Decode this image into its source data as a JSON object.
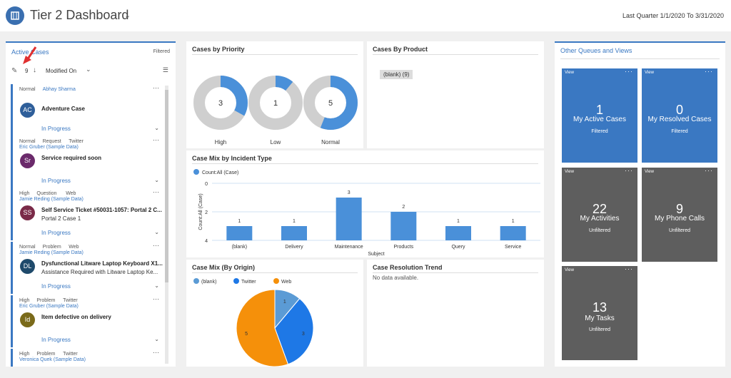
{
  "header": {
    "title": "Tier 2 Dashboard",
    "date_range": "Last Quarter 1/1/2020 To 3/31/2020"
  },
  "left_panel": {
    "title": "Active Cases",
    "filter": "Filtered",
    "count": "9",
    "sort": "Modified On",
    "cases": [
      {
        "tags": [
          "Normal",
          "Abhay Sharma"
        ],
        "initials": "AC",
        "color": "#2f5f9a",
        "title": "Adventure Case",
        "subtitle": "",
        "status": "In Progress"
      },
      {
        "tags": [
          "Normal",
          "Request",
          "Twitter"
        ],
        "owner": "Eric Gruber (Sample Data)",
        "initials": "Sr",
        "color": "#6b2a6b",
        "title": "Service required soon",
        "subtitle": "",
        "status": "In Progress"
      },
      {
        "tags": [
          "High",
          "Question",
          "Web"
        ],
        "owner": "Jamie Reding (Sample Data)",
        "initials": "SS",
        "color": "#7a2a48",
        "title": "Self Service Ticket #50031-1057: Portal 2 C...",
        "subtitle": "Portal 2 Case 1",
        "status": "In Progress"
      },
      {
        "tags": [
          "Normal",
          "Problem",
          "Web"
        ],
        "owner": "Jamie Reding (Sample Data)",
        "initials": "DL",
        "color": "#1f4a6b",
        "title": "Dysfunctional Litware Laptop Keyboard X1...",
        "subtitle": "Assistance Required with Litware Laptop Ke...",
        "status": "In Progress"
      },
      {
        "tags": [
          "High",
          "Problem",
          "Twitter"
        ],
        "owner": "Eric Gruber (Sample Data)",
        "initials": "Id",
        "color": "#7a6a1a",
        "title": "Item defective on delivery",
        "subtitle": "",
        "status": "In Progress"
      },
      {
        "tags": [
          "High",
          "Problem",
          "Twitter"
        ],
        "owner": "Veronica Quek (Sample Data)"
      }
    ]
  },
  "priority": {
    "title": "Cases by Priority",
    "donuts": [
      {
        "label": "High",
        "value": "3",
        "fraction": 0.33
      },
      {
        "label": "Low",
        "value": "1",
        "fraction": 0.11
      },
      {
        "label": "Normal",
        "value": "5",
        "fraction": 0.56
      }
    ]
  },
  "product": {
    "title": "Cases By Product",
    "chip": "(blank) (9)"
  },
  "queues": {
    "title": "Other Queues and Views",
    "tiles": [
      {
        "label": "View",
        "num": "1",
        "title": "My Active Cases",
        "sub": "Filtered",
        "color": "#3a78c2"
      },
      {
        "label": "View",
        "num": "0",
        "title": "My Resolved Cases",
        "sub": "Filtered",
        "color": "#3a78c2"
      },
      {
        "label": "View",
        "num": "22",
        "title": "My Activities",
        "sub": "Unfiltered",
        "color": "#5e5e5e"
      },
      {
        "label": "View",
        "num": "9",
        "title": "My Phone Calls",
        "sub": "Unfiltered",
        "color": "#5e5e5e"
      },
      {
        "label": "View",
        "num": "13",
        "title": "My Tasks",
        "sub": "Unfiltered",
        "color": "#5e5e5e"
      }
    ]
  },
  "mix": {
    "title": "Case Mix by Incident Type",
    "legend": "Count:All (Case)",
    "ylabel": "Count:All (Case)",
    "xlabel": "Subject"
  },
  "origin": {
    "title": "Case Mix (By Origin)",
    "legend": [
      "(blank)",
      "Twitter",
      "Web"
    ],
    "labels": [
      "1",
      "3",
      "5"
    ]
  },
  "trend": {
    "title": "Case Resolution Trend",
    "empty": "No data available."
  },
  "chart_data": [
    {
      "type": "bar",
      "title": "Case Mix by Incident Type",
      "categories": [
        "(blank)",
        "Delivery",
        "Maintenance",
        "Products",
        "Query",
        "Service"
      ],
      "values": [
        1,
        1,
        3,
        2,
        1,
        1
      ],
      "ylim": [
        0,
        4
      ],
      "yticks": [
        "0",
        "2",
        "4"
      ],
      "xlabel": "Subject",
      "ylabel": "Count:All (Case)",
      "color": "#4a90d9"
    },
    {
      "type": "pie",
      "title": "Case Mix (By Origin)",
      "categories": [
        "(blank)",
        "Twitter",
        "Web"
      ],
      "values": [
        1,
        3,
        5
      ],
      "colors": [
        "#5b9bd5",
        "#1e78e6",
        "#f5900a"
      ]
    }
  ]
}
